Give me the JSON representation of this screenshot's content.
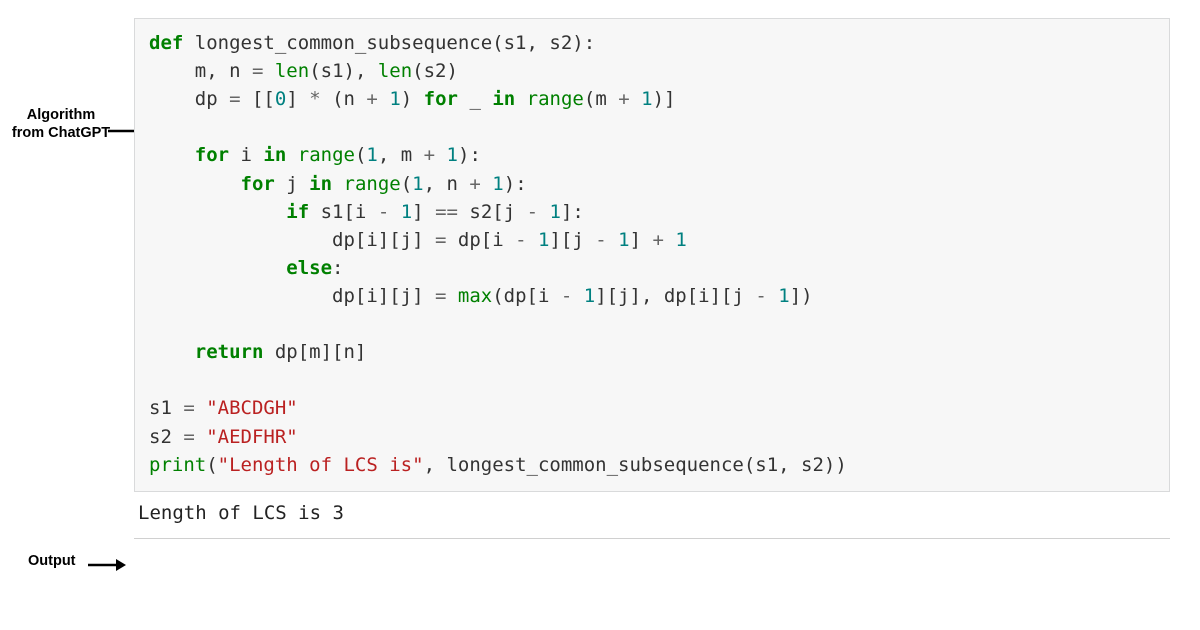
{
  "labels": {
    "algorithm_line1": "Algorithm",
    "algorithm_line2": "from ChatGPT",
    "output": "Output"
  },
  "code": {
    "tokens": [
      {
        "c": "kw",
        "t": "def"
      },
      {
        "c": "id",
        "t": " longest_common_subsequence(s1, s2):"
      },
      "NL",
      {
        "c": "id",
        "t": "    m, n "
      },
      {
        "c": "op",
        "t": "="
      },
      {
        "c": "id",
        "t": " "
      },
      {
        "c": "bi",
        "t": "len"
      },
      {
        "c": "id",
        "t": "(s1), "
      },
      {
        "c": "bi",
        "t": "len"
      },
      {
        "c": "id",
        "t": "(s2)"
      },
      "NL",
      {
        "c": "id",
        "t": "    dp "
      },
      {
        "c": "op",
        "t": "="
      },
      {
        "c": "id",
        "t": " [["
      },
      {
        "c": "num",
        "t": "0"
      },
      {
        "c": "id",
        "t": "] "
      },
      {
        "c": "op",
        "t": "*"
      },
      {
        "c": "id",
        "t": " (n "
      },
      {
        "c": "op",
        "t": "+"
      },
      {
        "c": "id",
        "t": " "
      },
      {
        "c": "num",
        "t": "1"
      },
      {
        "c": "id",
        "t": ") "
      },
      {
        "c": "kw",
        "t": "for"
      },
      {
        "c": "id",
        "t": " _ "
      },
      {
        "c": "kw",
        "t": "in"
      },
      {
        "c": "id",
        "t": " "
      },
      {
        "c": "bi",
        "t": "range"
      },
      {
        "c": "id",
        "t": "(m "
      },
      {
        "c": "op",
        "t": "+"
      },
      {
        "c": "id",
        "t": " "
      },
      {
        "c": "num",
        "t": "1"
      },
      {
        "c": "id",
        "t": ")]"
      },
      "NL",
      "NL",
      {
        "c": "id",
        "t": "    "
      },
      {
        "c": "kw",
        "t": "for"
      },
      {
        "c": "id",
        "t": " i "
      },
      {
        "c": "kw",
        "t": "in"
      },
      {
        "c": "id",
        "t": " "
      },
      {
        "c": "bi",
        "t": "range"
      },
      {
        "c": "id",
        "t": "("
      },
      {
        "c": "num",
        "t": "1"
      },
      {
        "c": "id",
        "t": ", m "
      },
      {
        "c": "op",
        "t": "+"
      },
      {
        "c": "id",
        "t": " "
      },
      {
        "c": "num",
        "t": "1"
      },
      {
        "c": "id",
        "t": "):"
      },
      "NL",
      {
        "c": "id",
        "t": "        "
      },
      {
        "c": "kw",
        "t": "for"
      },
      {
        "c": "id",
        "t": " j "
      },
      {
        "c": "kw",
        "t": "in"
      },
      {
        "c": "id",
        "t": " "
      },
      {
        "c": "bi",
        "t": "range"
      },
      {
        "c": "id",
        "t": "("
      },
      {
        "c": "num",
        "t": "1"
      },
      {
        "c": "id",
        "t": ", n "
      },
      {
        "c": "op",
        "t": "+"
      },
      {
        "c": "id",
        "t": " "
      },
      {
        "c": "num",
        "t": "1"
      },
      {
        "c": "id",
        "t": "):"
      },
      "NL",
      {
        "c": "id",
        "t": "            "
      },
      {
        "c": "kw",
        "t": "if"
      },
      {
        "c": "id",
        "t": " s1[i "
      },
      {
        "c": "op",
        "t": "-"
      },
      {
        "c": "id",
        "t": " "
      },
      {
        "c": "num",
        "t": "1"
      },
      {
        "c": "id",
        "t": "] "
      },
      {
        "c": "op",
        "t": "=="
      },
      {
        "c": "id",
        "t": " s2[j "
      },
      {
        "c": "op",
        "t": "-"
      },
      {
        "c": "id",
        "t": " "
      },
      {
        "c": "num",
        "t": "1"
      },
      {
        "c": "id",
        "t": "]:"
      },
      "NL",
      {
        "c": "id",
        "t": "                dp[i][j] "
      },
      {
        "c": "op",
        "t": "="
      },
      {
        "c": "id",
        "t": " dp[i "
      },
      {
        "c": "op",
        "t": "-"
      },
      {
        "c": "id",
        "t": " "
      },
      {
        "c": "num",
        "t": "1"
      },
      {
        "c": "id",
        "t": "][j "
      },
      {
        "c": "op",
        "t": "-"
      },
      {
        "c": "id",
        "t": " "
      },
      {
        "c": "num",
        "t": "1"
      },
      {
        "c": "id",
        "t": "] "
      },
      {
        "c": "op",
        "t": "+"
      },
      {
        "c": "id",
        "t": " "
      },
      {
        "c": "num",
        "t": "1"
      },
      "NL",
      {
        "c": "id",
        "t": "            "
      },
      {
        "c": "kw",
        "t": "else"
      },
      {
        "c": "id",
        "t": ":"
      },
      "NL",
      {
        "c": "id",
        "t": "                dp[i][j] "
      },
      {
        "c": "op",
        "t": "="
      },
      {
        "c": "id",
        "t": " "
      },
      {
        "c": "bi",
        "t": "max"
      },
      {
        "c": "id",
        "t": "(dp[i "
      },
      {
        "c": "op",
        "t": "-"
      },
      {
        "c": "id",
        "t": " "
      },
      {
        "c": "num",
        "t": "1"
      },
      {
        "c": "id",
        "t": "][j], dp[i][j "
      },
      {
        "c": "op",
        "t": "-"
      },
      {
        "c": "id",
        "t": " "
      },
      {
        "c": "num",
        "t": "1"
      },
      {
        "c": "id",
        "t": "])"
      },
      "NL",
      "NL",
      {
        "c": "id",
        "t": "    "
      },
      {
        "c": "kw",
        "t": "return"
      },
      {
        "c": "id",
        "t": " dp[m][n]"
      },
      "NL",
      "NL",
      {
        "c": "id",
        "t": "s1 "
      },
      {
        "c": "op",
        "t": "="
      },
      {
        "c": "id",
        "t": " "
      },
      {
        "c": "str",
        "t": "\"ABCDGH\""
      },
      "NL",
      {
        "c": "id",
        "t": "s2 "
      },
      {
        "c": "op",
        "t": "="
      },
      {
        "c": "id",
        "t": " "
      },
      {
        "c": "str",
        "t": "\"AEDFHR\""
      },
      "NL",
      {
        "c": "bi",
        "t": "print"
      },
      {
        "c": "id",
        "t": "("
      },
      {
        "c": "str",
        "t": "\"Length of LCS is\""
      },
      {
        "c": "id",
        "t": ", longest_common_subsequence(s1, s2))"
      }
    ]
  },
  "output_text": "Length of LCS is 3"
}
